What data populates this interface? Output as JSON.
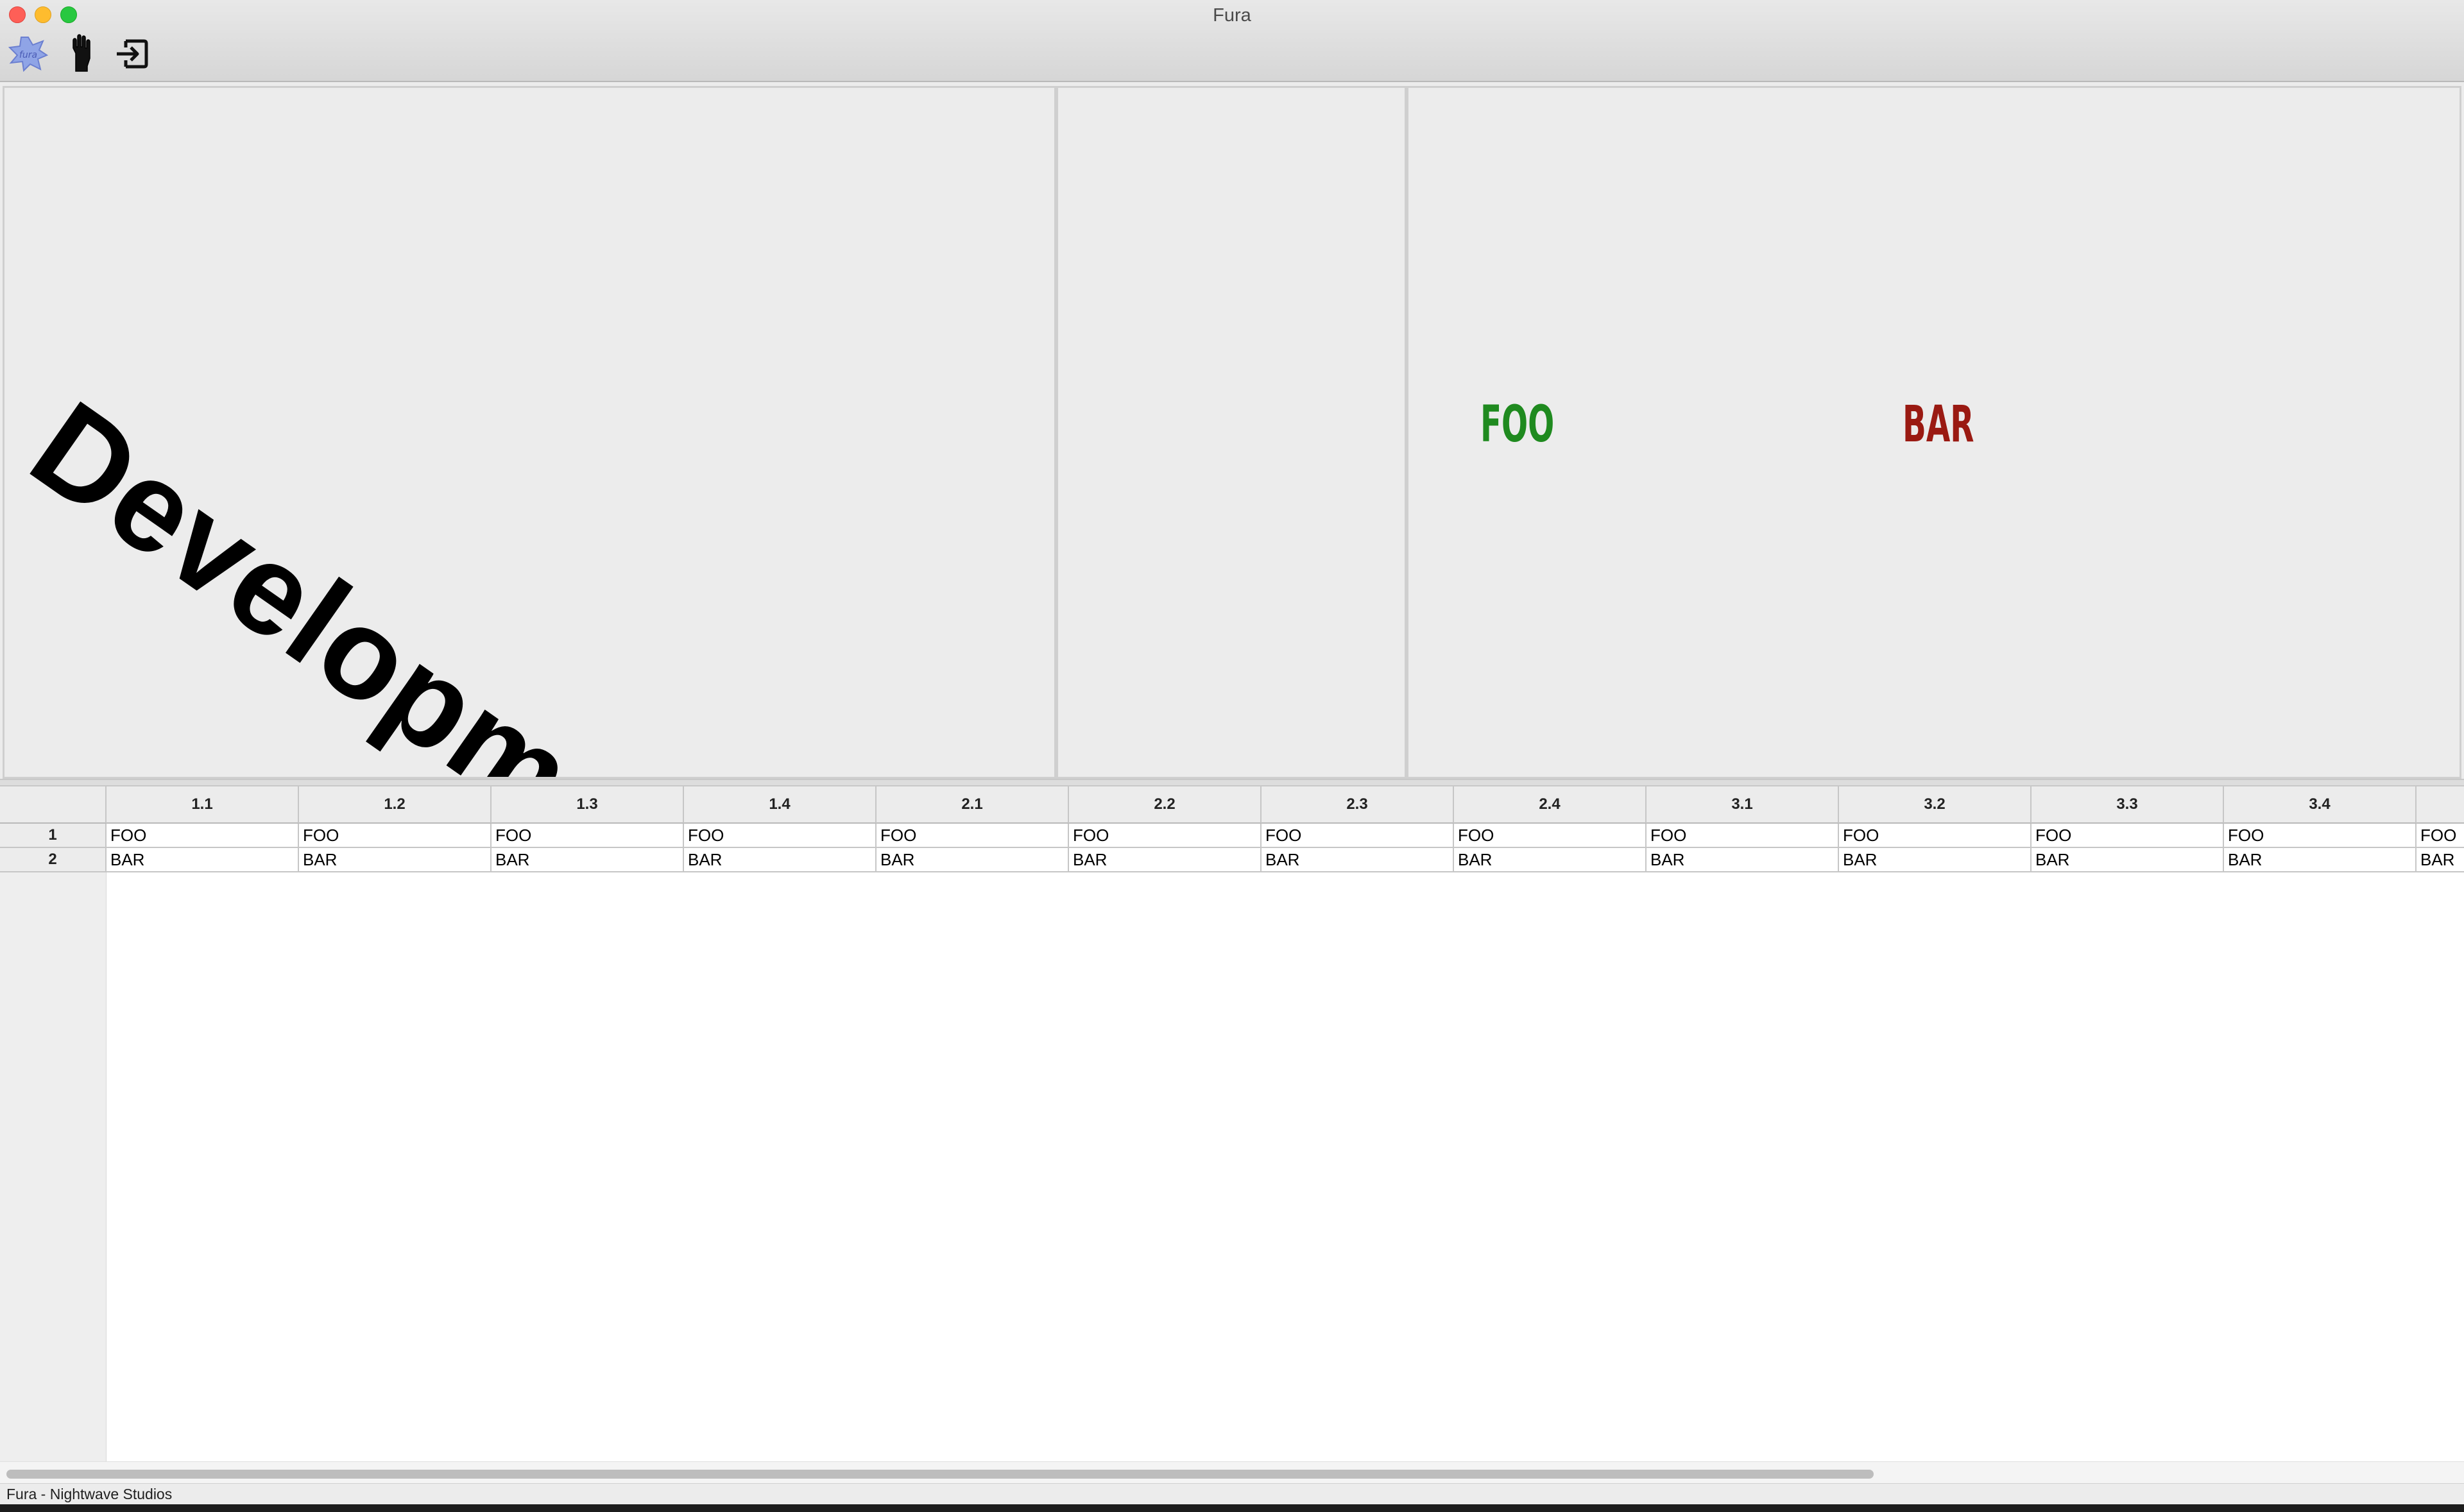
{
  "window": {
    "title": "Fura",
    "traffic_lights": [
      "close",
      "minimize",
      "zoom"
    ]
  },
  "toolbar": {
    "items": [
      {
        "name": "app-logo-icon",
        "hint": "Fura logo"
      },
      {
        "name": "hand-icon"
      },
      {
        "name": "exit-icon"
      }
    ]
  },
  "panes": {
    "watermark": "Development Build",
    "labels": {
      "foo": {
        "text": "FOO",
        "color": "#1f8a1f"
      },
      "bar": {
        "text": "BAR",
        "color": "#9a1a12"
      }
    }
  },
  "table": {
    "columns": [
      "1.1",
      "1.2",
      "1.3",
      "1.4",
      "2.1",
      "2.2",
      "2.3",
      "2.4",
      "3.1",
      "3.2",
      "3.3",
      "3.4",
      ""
    ],
    "rows": [
      {
        "header": "1",
        "cells": [
          "FOO",
          "FOO",
          "FOO",
          "FOO",
          "FOO",
          "FOO",
          "FOO",
          "FOO",
          "FOO",
          "FOO",
          "FOO",
          "FOO",
          "FOO"
        ]
      },
      {
        "header": "2",
        "cells": [
          "BAR",
          "BAR",
          "BAR",
          "BAR",
          "BAR",
          "BAR",
          "BAR",
          "BAR",
          "BAR",
          "BAR",
          "BAR",
          "BAR",
          "BAR"
        ]
      }
    ]
  },
  "statusbar": {
    "text": "Fura - Nightwave Studios"
  }
}
